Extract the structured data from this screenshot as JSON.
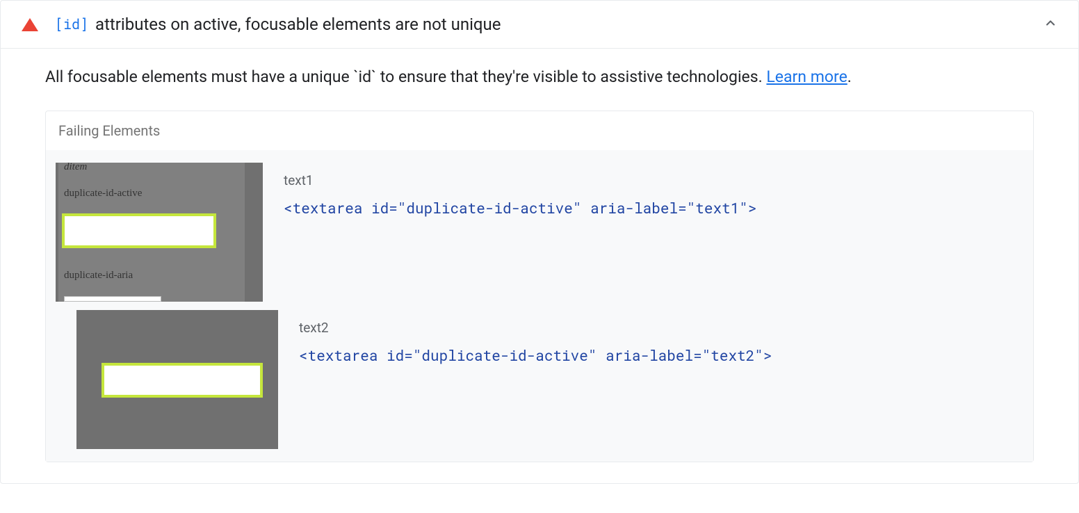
{
  "audit": {
    "badge": "[id]",
    "title": "attributes on active, focusable elements are not unique",
    "description_pre": "All focusable elements must have a unique `id` to ensure that they're visible to assistive technologies. ",
    "learn_more": "Learn more",
    "description_post": "."
  },
  "failing": {
    "header": "Failing Elements",
    "items": [
      {
        "label": "text1",
        "code": "<textarea id=\"duplicate-id-active\" aria-label=\"text1\">",
        "thumb_lines": [
          "ditem",
          "duplicate-id-active",
          "duplicate-id-aria"
        ]
      },
      {
        "label": "text2",
        "code": "<textarea id=\"duplicate-id-active\" aria-label=\"text2\">"
      }
    ]
  }
}
